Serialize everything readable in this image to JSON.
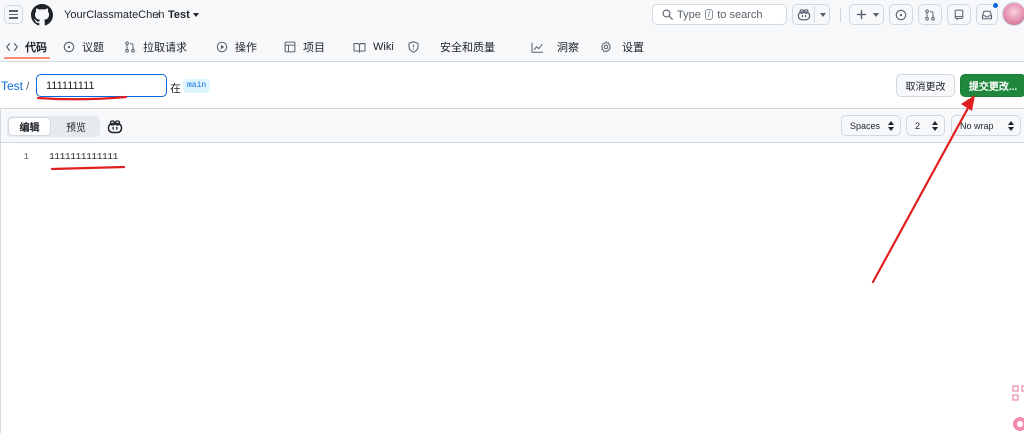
{
  "header": {
    "owner": "YourClassmateChen",
    "separator": "/",
    "repo": "Test",
    "search": {
      "prefix": "Type",
      "key": "/",
      "suffix": "to search"
    }
  },
  "tabs": [
    {
      "label": "代码",
      "icon": "code-icon",
      "active": true
    },
    {
      "label": "议题",
      "icon": "issue-opened-icon"
    },
    {
      "label": "拉取请求",
      "icon": "git-pull-request-icon"
    },
    {
      "label": "操作",
      "icon": "play-icon"
    },
    {
      "label": "项目",
      "icon": "table-icon"
    },
    {
      "label": "Wiki",
      "icon": "book-icon"
    },
    {
      "label": "安全和质量",
      "icon": "shield-icon"
    },
    {
      "label": "洞察",
      "icon": "graph-icon"
    },
    {
      "label": "设置",
      "icon": "gear-icon"
    }
  ],
  "path": {
    "repo": "Test",
    "separator": "/",
    "filename": "111111111",
    "in": "在",
    "branch": "main"
  },
  "actions": {
    "cancel_label": "取消更改",
    "commit_label": "提交更改..."
  },
  "editor": {
    "edit_label": "编辑",
    "preview_label": "预览",
    "indent_mode": "Spaces",
    "indent_size": "2",
    "wrap_mode": "No wrap",
    "lines": [
      {
        "number": "1",
        "text": "1111111111111"
      }
    ]
  },
  "colors": {
    "accent": "#0969da",
    "primary_button": "#1f883d",
    "tab_underline": "#fd8c73",
    "annotation": "#e02020"
  }
}
